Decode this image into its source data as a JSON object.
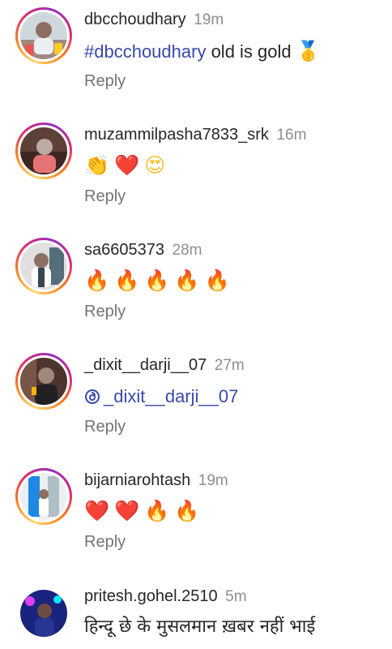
{
  "comments": [
    {
      "username": "dbcchoudhary",
      "time": "19m",
      "hashtag": "#dbcchoudhary",
      "text": " old is gold ",
      "emoji": "🥇",
      "reply": "Reply"
    },
    {
      "username": "muzammilpasha7833_srk",
      "time": "16m",
      "emojis": [
        "👏",
        "❤️",
        "😍"
      ],
      "reply": "Reply"
    },
    {
      "username": "sa6605373",
      "time": "28m",
      "emojis": [
        "🔥",
        "🔥",
        "🔥",
        "🔥",
        "🔥"
      ],
      "reply": "Reply"
    },
    {
      "username": "_dixit__darji__07",
      "time": "27m",
      "mention": "_dixit__darji__07",
      "reply": "Reply"
    },
    {
      "username": "bijarniarohtash",
      "time": "19m",
      "emojis": [
        "❤️",
        "❤️",
        "🔥",
        "🔥"
      ],
      "reply": "Reply"
    },
    {
      "username": "pritesh.gohel.2510",
      "time": "5m",
      "text": "हिन्दू छे के मुसलमान ख़बर नहीं भाई"
    }
  ],
  "colors": {
    "text": "#262626",
    "muted": "#737373",
    "link": "#3949ab",
    "story_ring": "#d62976"
  },
  "icons": {
    "mention": "threads-icon"
  }
}
